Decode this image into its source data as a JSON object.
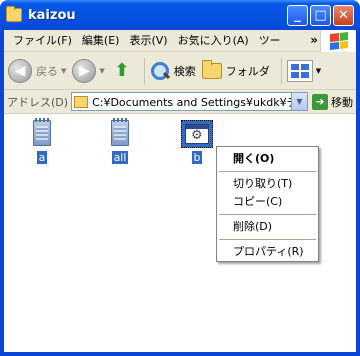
{
  "window": {
    "title": "kaizou"
  },
  "title_buttons": {
    "minimize": "_",
    "maximize": "□",
    "close": "✕"
  },
  "menu": {
    "items": [
      "ファイル(F)",
      "編集(E)",
      "表示(V)",
      "お気に入り(A)",
      "ツー"
    ],
    "overflow": "»"
  },
  "toolbar": {
    "back": "戻る",
    "search": "検索",
    "folders": "フォルダ"
  },
  "address": {
    "label": "アドレス(D)",
    "value": "C:¥Documents and Settings¥ukdk¥デ...",
    "go": "移動"
  },
  "files": [
    {
      "name": "a",
      "icon": "notepad-icon",
      "selected": false
    },
    {
      "name": "all",
      "icon": "notepad-icon",
      "selected": false
    },
    {
      "name": "b",
      "icon": "batch-file-icon",
      "selected": true
    }
  ],
  "context_menu": {
    "open": "開く(O)",
    "cut": "切り取り(T)",
    "copy": "コピー(C)",
    "delete": "削除(D)",
    "properties": "プロパティ(R)"
  },
  "colors": {
    "titlebar": "#0551e0",
    "selection": "#316ac5",
    "chrome": "#ece9d8"
  }
}
